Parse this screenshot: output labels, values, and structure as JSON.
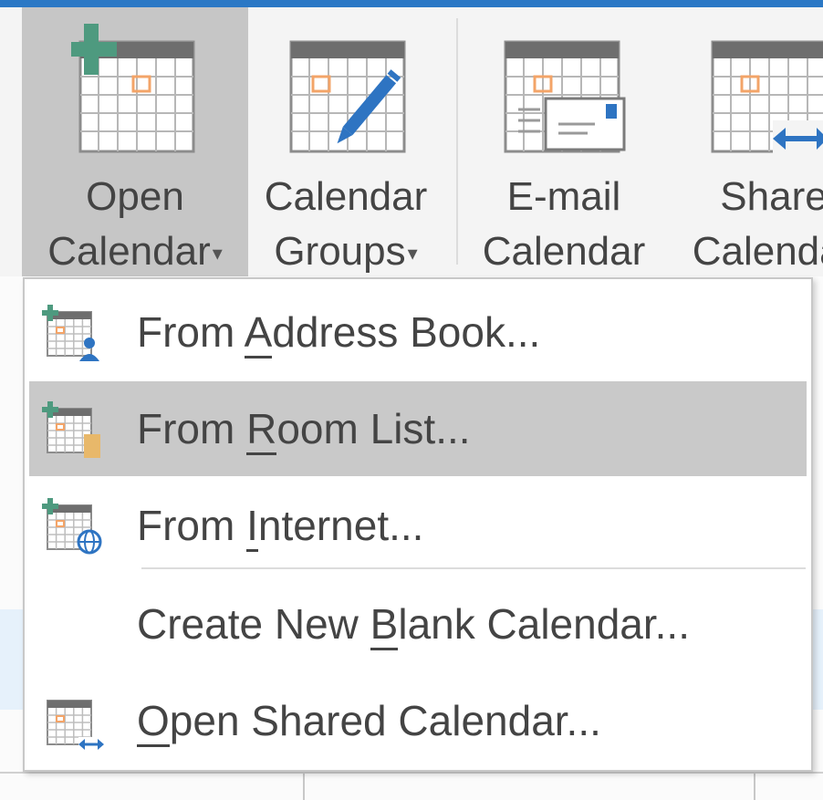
{
  "ribbon": {
    "buttons": [
      {
        "line1": "Open",
        "line2": "Calendar",
        "dropdown": true,
        "active": true,
        "icon": "add-calendar-icon"
      },
      {
        "line1": "Calendar",
        "line2": "Groups",
        "dropdown": true,
        "active": false,
        "icon": "calendar-groups-icon"
      },
      {
        "line1": "E-mail",
        "line2": "Calendar",
        "dropdown": false,
        "active": false,
        "icon": "email-calendar-icon"
      },
      {
        "line1": "Share",
        "line2": "Calendar",
        "dropdown": false,
        "active": false,
        "icon": "share-calendar-icon"
      }
    ]
  },
  "menu": {
    "items": [
      {
        "pre": "From ",
        "key": "A",
        "post": "ddress Book...",
        "icon": "address-book-calendar-icon",
        "highlighted": false
      },
      {
        "pre": "From ",
        "key": "R",
        "post": "oom List...",
        "icon": "room-list-calendar-icon",
        "highlighted": true
      },
      {
        "pre": "From ",
        "key": "I",
        "post": "nternet...",
        "icon": "internet-calendar-icon",
        "highlighted": false
      },
      {
        "pre": "Create New ",
        "key": "B",
        "post": "lank Calendar...",
        "icon": "",
        "highlighted": false
      },
      {
        "pre": "",
        "key": "O",
        "post": "pen Shared Calendar...",
        "icon": "shared-calendar-icon",
        "highlighted": false
      }
    ]
  },
  "colors": {
    "accent_top": "#2b78c5",
    "highlight": "#c9c9c9",
    "plus_green": "#4e9a7f",
    "calendar_gray": "#6e6e6e",
    "orange": "#f3a468",
    "blue": "#2e74c2"
  }
}
